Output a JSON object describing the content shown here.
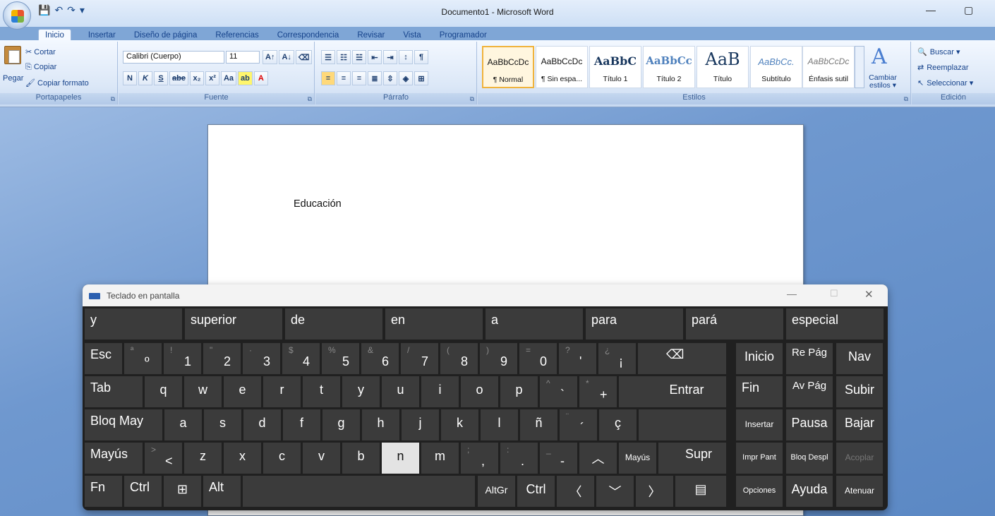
{
  "app": {
    "title": "Documento1 - Microsoft Word",
    "quick_access": [
      "💾",
      "↶",
      "↷",
      "▾"
    ],
    "window_min": "—",
    "window_max": "▢"
  },
  "tabs": [
    "Inicio",
    "Insertar",
    "Diseño de página",
    "Referencias",
    "Correspondencia",
    "Revisar",
    "Vista",
    "Programador"
  ],
  "ribbon": {
    "clipboard": {
      "paste": "Pegar",
      "cut": "Cortar",
      "copy": "Copiar",
      "format_painter": "Copiar formato",
      "label": "Portapapeles"
    },
    "font": {
      "family": "Calibri (Cuerpo)",
      "size": "11",
      "label": "Fuente"
    },
    "paragraph": {
      "label": "Párrafo"
    },
    "styles": {
      "label": "Estilos",
      "items": [
        {
          "preview": "AaBbCcDc",
          "name": "¶ Normal"
        },
        {
          "preview": "AaBbCcDc",
          "name": "¶ Sin espa..."
        },
        {
          "preview": "AaBbC",
          "name": "Título 1"
        },
        {
          "preview": "AaBbCc",
          "name": "Título 2"
        },
        {
          "preview": "AaB",
          "name": "Título"
        },
        {
          "preview": "AaBbCc.",
          "name": "Subtítulo"
        },
        {
          "preview": "AaBbCcDc",
          "name": "Énfasis sutil"
        }
      ],
      "change_styles": "Cambiar estilos ▾"
    },
    "editing": {
      "find": "Buscar ▾",
      "replace": "Reemplazar",
      "select": "Seleccionar ▾",
      "label": "Edición"
    }
  },
  "document": {
    "text": "Educación"
  },
  "osk": {
    "title": "Teclado en pantalla",
    "min": "—",
    "max": "☐",
    "close": "✕",
    "suggestions": [
      "y",
      "superior",
      "de",
      "en",
      "a",
      "para",
      "pará",
      "especial"
    ],
    "row1": {
      "esc": "Esc",
      "keys": [
        {
          "sup": "ª",
          "main": "º"
        },
        {
          "sup": "!",
          "main": "1"
        },
        {
          "sup": "\"",
          "main": "2"
        },
        {
          "sup": "·",
          "main": "3"
        },
        {
          "sup": "$",
          "main": "4"
        },
        {
          "sup": "%",
          "main": "5"
        },
        {
          "sup": "&",
          "main": "6"
        },
        {
          "sup": "/",
          "main": "7"
        },
        {
          "sup": "(",
          "main": "8"
        },
        {
          "sup": ")",
          "main": "9"
        },
        {
          "sup": "=",
          "main": "0"
        },
        {
          "sup": "?",
          "main": "'"
        },
        {
          "sup": "¿",
          "main": "¡"
        }
      ],
      "backspace": "⌫",
      "home": "Inicio",
      "pgup": "Re Pág",
      "nav": "Nav"
    },
    "row2": {
      "tab": "Tab",
      "letters": [
        "q",
        "w",
        "e",
        "r",
        "t",
        "y",
        "u",
        "i",
        "o",
        "p"
      ],
      "grave": {
        "sup": "^",
        "main": "`"
      },
      "plus": {
        "sup": "*",
        "main": "+"
      },
      "enter": "Entrar",
      "end": "Fin",
      "pgdn": "Av Pág",
      "up": "Subir"
    },
    "row3": {
      "caps": "Bloq May",
      "letters": [
        "a",
        "s",
        "d",
        "f",
        "g",
        "h",
        "j",
        "k",
        "l",
        "ñ"
      ],
      "acute": {
        "sup": "¨",
        "main": "´"
      },
      "cedilla": "ç",
      "insert": "Insertar",
      "pause": "Pausa",
      "down": "Bajar"
    },
    "row4": {
      "shift": "Mayús",
      "lt": {
        "sup": ">",
        "main": "<"
      },
      "letters": [
        "z",
        "x",
        "c",
        "v",
        "b",
        "n",
        "m"
      ],
      "comma": {
        "sup": ";",
        "main": ","
      },
      "period": {
        "sup": ":",
        "main": "."
      },
      "dash": {
        "sup": "_",
        "main": "-"
      },
      "arrow_up": "︿",
      "shift_r": "Mayús",
      "del": "Supr",
      "prtsc": "Impr Pant",
      "scrlk": "Bloq Despl",
      "dock": "Acoplar"
    },
    "row5": {
      "fn": "Fn",
      "ctrl": "Ctrl",
      "win": "⊞",
      "alt": "Alt",
      "altgr": "AltGr",
      "ctrl_r": "Ctrl",
      "left": "〈",
      "down": "﹀",
      "right": "〉",
      "menu": "▤",
      "options": "Opciones",
      "help": "Ayuda",
      "fade": "Atenuar"
    },
    "pressed_key": "n"
  }
}
